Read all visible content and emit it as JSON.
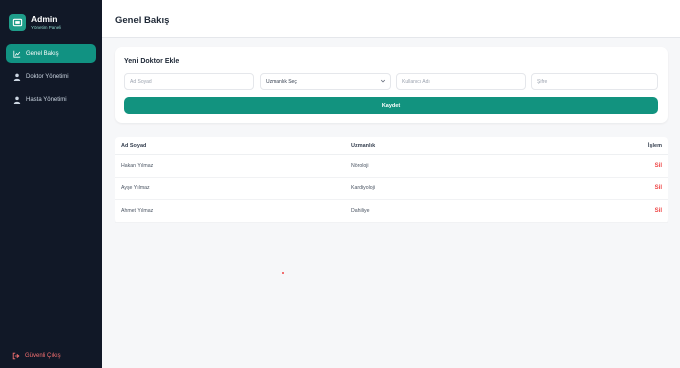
{
  "sidebar": {
    "brand_title": "Admin",
    "brand_subtitle": "Yönetim Paneli",
    "items": [
      {
        "label": "Genel Bakış",
        "icon": "chart-icon",
        "active": true
      },
      {
        "label": "Doktor Yönetimi",
        "icon": "user-icon",
        "active": false
      },
      {
        "label": "Hasta Yönetimi",
        "icon": "user-icon",
        "active": false
      }
    ],
    "logout_label": "Güvenli Çıkış"
  },
  "header": {
    "title": "Genel Bakış"
  },
  "form": {
    "title": "Yeni Doktor Ekle",
    "name_placeholder": "Ad Soyad",
    "specialty_selected": "Uzmanlık Seç",
    "username_placeholder": "Kullanıcı Adı",
    "password_placeholder": "Şifre",
    "submit_label": "Kaydet"
  },
  "table": {
    "headers": [
      "Ad Soyad",
      "Uzmanlık",
      "İşlem"
    ],
    "rows": [
      {
        "name": "Hakan Yılmaz",
        "specialty": "Nöroloji",
        "action": "Sil"
      },
      {
        "name": "Ayşe Yılmaz",
        "specialty": "Kardiyoloji",
        "action": "Sil"
      },
      {
        "name": "Ahmet Yılmaz",
        "specialty": "Dahiliye",
        "action": "Sil"
      }
    ]
  },
  "colors": {
    "sidebar_bg": "#111827",
    "accent": "#12937f",
    "danger": "#ef4444"
  }
}
